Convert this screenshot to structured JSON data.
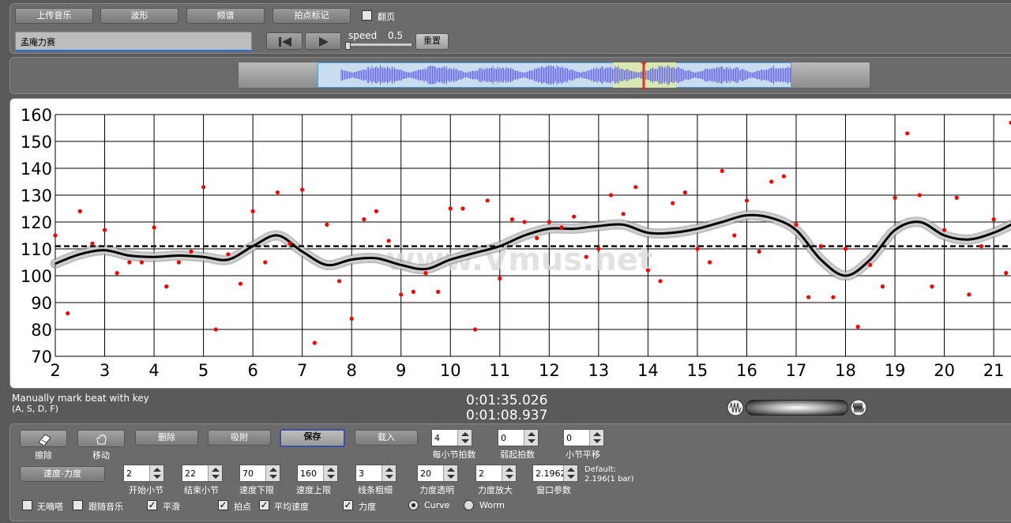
{
  "toolbar": {
    "upload_label": "上传音乐",
    "waveform_label": "波形",
    "spectrum_label": "频谱",
    "beat_mark_label": "拍点标记",
    "flip_label": "翻页",
    "title_value": "孟庵力赛",
    "speed_label": "speed",
    "speed_value": "0.5",
    "reset_label": "重置"
  },
  "chart_data": {
    "type": "scatter",
    "title": "",
    "xlabel": "",
    "ylabel": "",
    "xlim": [
      2,
      21.35
    ],
    "ylim": [
      70,
      160
    ],
    "xticks": [
      2,
      3,
      4,
      5,
      6,
      7,
      8,
      9,
      10,
      11,
      12,
      13,
      14,
      15,
      16,
      17,
      18,
      19,
      20,
      21
    ],
    "yticks": [
      70,
      80,
      90,
      100,
      110,
      120,
      130,
      140,
      150,
      160
    ],
    "grid": true,
    "watermark": "www.Vmus.net",
    "mean_line": 111,
    "points": [
      [
        2.0,
        115
      ],
      [
        2.25,
        86
      ],
      [
        2.5,
        124
      ],
      [
        2.75,
        112
      ],
      [
        3.0,
        117
      ],
      [
        3.25,
        101
      ],
      [
        3.5,
        105
      ],
      [
        3.75,
        105
      ],
      [
        4.0,
        118
      ],
      [
        4.25,
        96
      ],
      [
        4.5,
        105
      ],
      [
        4.75,
        109
      ],
      [
        5.0,
        133
      ],
      [
        5.25,
        80
      ],
      [
        5.5,
        108
      ],
      [
        5.75,
        97
      ],
      [
        6.0,
        124
      ],
      [
        6.25,
        105
      ],
      [
        6.5,
        131
      ],
      [
        6.75,
        112
      ],
      [
        7.0,
        132
      ],
      [
        7.25,
        75
      ],
      [
        7.5,
        119
      ],
      [
        7.75,
        98
      ],
      [
        8.0,
        84
      ],
      [
        8.25,
        121
      ],
      [
        8.5,
        124
      ],
      [
        8.75,
        113
      ],
      [
        9.0,
        93
      ],
      [
        9.25,
        94
      ],
      [
        9.5,
        101
      ],
      [
        9.75,
        94
      ],
      [
        10.0,
        125
      ],
      [
        10.25,
        125
      ],
      [
        10.5,
        80
      ],
      [
        10.75,
        128
      ],
      [
        11.0,
        99
      ],
      [
        11.25,
        121
      ],
      [
        11.5,
        120
      ],
      [
        11.75,
        114
      ],
      [
        12.0,
        120
      ],
      [
        12.25,
        118
      ],
      [
        12.5,
        122
      ],
      [
        12.75,
        107
      ],
      [
        13.0,
        110
      ],
      [
        13.25,
        130
      ],
      [
        13.5,
        123
      ],
      [
        13.75,
        133
      ],
      [
        14.0,
        102
      ],
      [
        14.25,
        98
      ],
      [
        14.5,
        127
      ],
      [
        14.75,
        131
      ],
      [
        15.0,
        110
      ],
      [
        15.25,
        105
      ],
      [
        15.5,
        139
      ],
      [
        15.75,
        115
      ],
      [
        16.0,
        128
      ],
      [
        16.25,
        109
      ],
      [
        16.5,
        135
      ],
      [
        16.75,
        137
      ],
      [
        17.0,
        119
      ],
      [
        17.25,
        92
      ],
      [
        17.5,
        111
      ],
      [
        17.75,
        92
      ],
      [
        18.0,
        110
      ],
      [
        18.25,
        81
      ],
      [
        18.5,
        104
      ],
      [
        18.75,
        96
      ],
      [
        19.0,
        129
      ],
      [
        19.25,
        153
      ],
      [
        19.5,
        130
      ],
      [
        19.75,
        96
      ],
      [
        20.0,
        117
      ],
      [
        20.25,
        129
      ],
      [
        20.5,
        93
      ],
      [
        20.75,
        111
      ],
      [
        21.0,
        121
      ],
      [
        21.25,
        101
      ],
      [
        21.35,
        157
      ]
    ],
    "curve": [
      [
        2.0,
        104.5
      ],
      [
        2.5,
        108
      ],
      [
        3.0,
        109.5
      ],
      [
        3.5,
        107.5
      ],
      [
        4.0,
        107
      ],
      [
        4.5,
        107.5
      ],
      [
        5.0,
        107
      ],
      [
        5.5,
        106
      ],
      [
        6.0,
        111
      ],
      [
        6.5,
        115
      ],
      [
        7.0,
        109
      ],
      [
        7.5,
        104
      ],
      [
        8.0,
        106
      ],
      [
        8.5,
        106.5
      ],
      [
        9.0,
        104
      ],
      [
        9.5,
        102.5
      ],
      [
        10.0,
        106
      ],
      [
        10.5,
        108.5
      ],
      [
        11.0,
        111
      ],
      [
        11.5,
        115
      ],
      [
        12.0,
        117.5
      ],
      [
        12.5,
        117.5
      ],
      [
        13.0,
        118.5
      ],
      [
        13.5,
        119
      ],
      [
        14.0,
        116
      ],
      [
        14.5,
        116
      ],
      [
        15.0,
        117.5
      ],
      [
        15.5,
        120
      ],
      [
        16.0,
        122.5
      ],
      [
        16.5,
        121.5
      ],
      [
        17.0,
        117
      ],
      [
        17.5,
        106
      ],
      [
        18.0,
        100
      ],
      [
        18.5,
        106
      ],
      [
        19.0,
        117
      ],
      [
        19.5,
        120
      ],
      [
        20.0,
        115
      ],
      [
        20.5,
        113.5
      ],
      [
        21.0,
        116
      ],
      [
        21.35,
        119
      ]
    ]
  },
  "info": {
    "hint_line1": "Manually mark beat with key",
    "hint_line2": "(A, S, D, F)",
    "time1": "0:01:35.026",
    "time2": "0:01:08.937"
  },
  "controls": {
    "erase_label": "擦除",
    "move_label": "移动",
    "delete_label": "删除",
    "snap_label": "吸附",
    "save_label": "保存",
    "load_label": "载入",
    "beats_per_bar_value": "4",
    "beats_per_bar_label": "每小节拍数",
    "pickup_value": "0",
    "pickup_label": "弱起拍数",
    "bar_shift_value": "0",
    "bar_shift_label": "小节平移",
    "tempo_dynamics_label": "速度-力度",
    "start_bar_value": "2",
    "start_bar_label": "开始小节",
    "end_bar_value": "22",
    "end_bar_label": "结束小节",
    "tempo_low_value": "70",
    "tempo_low_label": "速度下限",
    "tempo_high_value": "160",
    "tempo_high_label": "速度上限",
    "line_width_value": "3",
    "line_width_label": "线条粗细",
    "dyn_opacity_value": "20",
    "dyn_opacity_label": "力度透明",
    "dyn_scale_value": "2",
    "dyn_scale_label": "力度放大",
    "window_value": "2.1962",
    "window_label": "窗口参数",
    "default_line1": "Default:",
    "default_line2": "2.196(1 bar)",
    "no_click_label": "无嘀嗒",
    "follow_music_label": "跟随音乐",
    "smooth_label": "平滑",
    "beat_points_label": "拍点",
    "avg_tempo_label": "平均速度",
    "dynamics_label": "力度",
    "curve_label": "Curve",
    "worm_label": "Worm"
  }
}
